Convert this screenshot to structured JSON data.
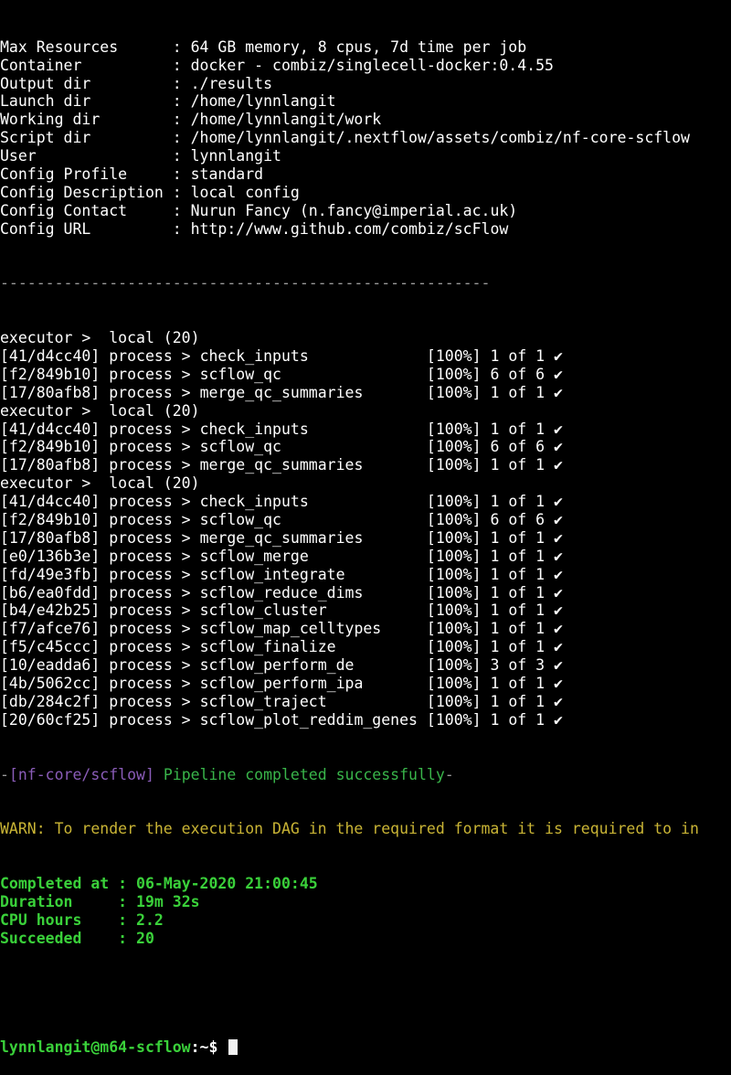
{
  "config": [
    {
      "key": "Max Resources     ",
      "value": "64 GB memory, 8 cpus, 7d time per job"
    },
    {
      "key": "Container         ",
      "value": "docker - combiz/singlecell-docker:0.4.55"
    },
    {
      "key": "Output dir        ",
      "value": "./results"
    },
    {
      "key": "Launch dir        ",
      "value": "/home/lynnlangit"
    },
    {
      "key": "Working dir       ",
      "value": "/home/lynnlangit/work"
    },
    {
      "key": "Script dir        ",
      "value": "/home/lynnlangit/.nextflow/assets/combiz/nf-core-scflow"
    },
    {
      "key": "User              ",
      "value": "lynnlangit"
    },
    {
      "key": "Config Profile    ",
      "value": "standard"
    },
    {
      "key": "Config Description",
      "value": "local config"
    },
    {
      "key": "Config Contact    ",
      "value": "Nurun Fancy (n.fancy@imperial.ac.uk)"
    },
    {
      "key": "Config URL        ",
      "value": "http://www.github.com/combiz/scFlow"
    }
  ],
  "separator": "------------------------------------------------------",
  "blocks": [
    {
      "executor": "executor >  local (20)",
      "processes": [
        {
          "hash": "[41/d4cc40]",
          "name": "check_inputs",
          "status": "[100%] 1 of 1",
          "check": "✔"
        },
        {
          "hash": "[f2/849b10]",
          "name": "scflow_qc",
          "status": "[100%] 6 of 6",
          "check": "✔"
        },
        {
          "hash": "[17/80afb8]",
          "name": "merge_qc_summaries",
          "status": "[100%] 1 of 1",
          "check": "✔"
        }
      ]
    },
    {
      "executor": "executor >  local (20)",
      "processes": [
        {
          "hash": "[41/d4cc40]",
          "name": "check_inputs",
          "status": "[100%] 1 of 1",
          "check": "✔"
        },
        {
          "hash": "[f2/849b10]",
          "name": "scflow_qc",
          "status": "[100%] 6 of 6",
          "check": "✔"
        },
        {
          "hash": "[17/80afb8]",
          "name": "merge_qc_summaries",
          "status": "[100%] 1 of 1",
          "check": "✔"
        }
      ]
    },
    {
      "executor": "executor >  local (20)",
      "processes": [
        {
          "hash": "[41/d4cc40]",
          "name": "check_inputs",
          "status": "[100%] 1 of 1",
          "check": "✔"
        },
        {
          "hash": "[f2/849b10]",
          "name": "scflow_qc",
          "status": "[100%] 6 of 6",
          "check": "✔"
        },
        {
          "hash": "[17/80afb8]",
          "name": "merge_qc_summaries",
          "status": "[100%] 1 of 1",
          "check": "✔"
        },
        {
          "hash": "[e0/136b3e]",
          "name": "scflow_merge",
          "status": "[100%] 1 of 1",
          "check": "✔"
        },
        {
          "hash": "[fd/49e3fb]",
          "name": "scflow_integrate",
          "status": "[100%] 1 of 1",
          "check": "✔"
        },
        {
          "hash": "[b6/ea0fdd]",
          "name": "scflow_reduce_dims",
          "status": "[100%] 1 of 1",
          "check": "✔"
        },
        {
          "hash": "[b4/e42b25]",
          "name": "scflow_cluster",
          "status": "[100%] 1 of 1",
          "check": "✔"
        },
        {
          "hash": "[f7/afce76]",
          "name": "scflow_map_celltypes",
          "status": "[100%] 1 of 1",
          "check": "✔"
        },
        {
          "hash": "[f5/c45ccc]",
          "name": "scflow_finalize",
          "status": "[100%] 1 of 1",
          "check": "✔"
        },
        {
          "hash": "[10/eadda6]",
          "name": "scflow_perform_de",
          "status": "[100%] 3 of 3",
          "check": "✔"
        },
        {
          "hash": "[4b/5062cc]",
          "name": "scflow_perform_ipa",
          "status": "[100%] 1 of 1",
          "check": "✔"
        },
        {
          "hash": "[db/284c2f]",
          "name": "scflow_traject",
          "status": "[100%] 1 of 1",
          "check": "✔"
        },
        {
          "hash": "[20/60cf25]",
          "name": "scflow_plot_reddim_genes",
          "status": "[100%] 1 of 1",
          "check": "✔"
        }
      ]
    }
  ],
  "pipeline": {
    "dash_open": "-",
    "tag": "[nf-core/scflow]",
    "message": "Pipeline completed successfully",
    "dash_close": "-"
  },
  "warn": "WARN: To render the execution DAG in the required format it is required to in",
  "summary": [
    {
      "label": "Completed at",
      "value": ": 06-May-2020 21:00:45"
    },
    {
      "label": "Duration    ",
      "value": ": 19m 32s"
    },
    {
      "label": "CPU hours   ",
      "value": ": 2.2"
    },
    {
      "label": "Succeeded   ",
      "value": ": 20"
    }
  ],
  "prompt": {
    "user_host": "lynnlangit@m64-scflow",
    "path": ":~$ "
  },
  "colors": {
    "background": "#000000",
    "text": "#ffffff",
    "separator": "#9a9a9a",
    "pipeline_tag": "#8a5cb8",
    "success": "#39b54a",
    "warn": "#c9b435",
    "summary": "#3ad13a"
  }
}
